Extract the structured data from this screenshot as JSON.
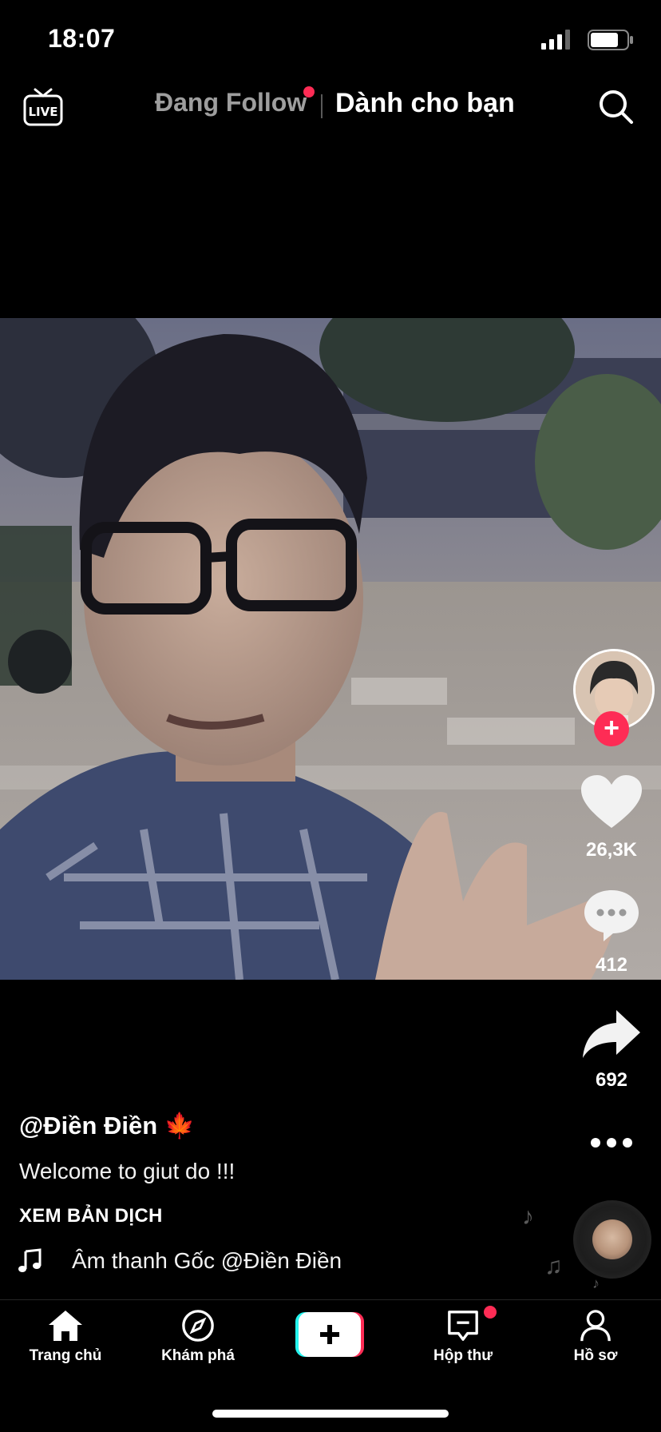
{
  "status_bar": {
    "time": "18:07"
  },
  "top_nav": {
    "live_label": "LIVE",
    "following_label": "Đang Follow",
    "for_you_label": "Dành cho bạn"
  },
  "post": {
    "username": "@Điền Điền 🍁",
    "caption": "Welcome to giut do !!!",
    "translate_label": "XEM BẢN DỊCH",
    "sound": "Âm thanh Gốc    @Điền Điền",
    "likes": "26,3K",
    "comments": "412",
    "shares": "692"
  },
  "tab_bar": {
    "home": "Trang chủ",
    "discover": "Khám phá",
    "inbox": "Hộp thư",
    "profile": "Hồ sơ"
  },
  "colors": {
    "accent_red": "#fe2c55",
    "create_cyan": "#25f4ee",
    "background": "#000000"
  }
}
